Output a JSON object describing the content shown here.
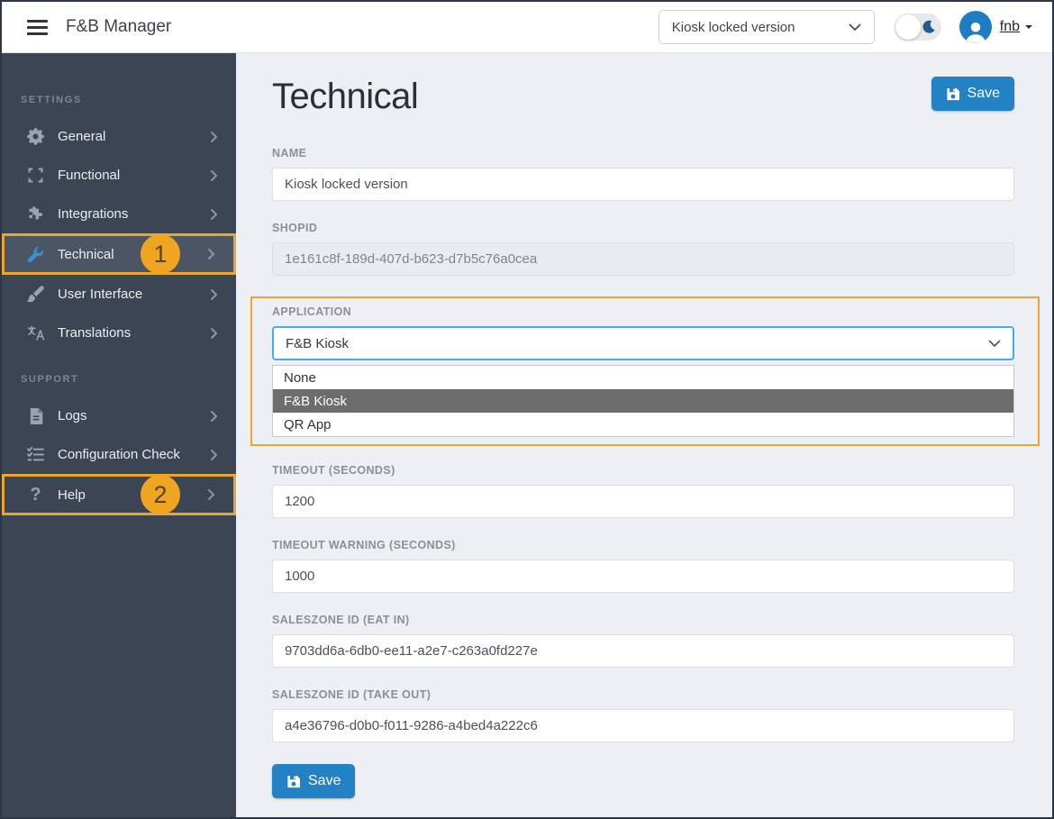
{
  "header": {
    "app_title": "F&B Manager",
    "shop_select": {
      "value": "Kiosk locked version"
    },
    "user_menu": {
      "username": "fnb"
    }
  },
  "sidebar": {
    "sections": [
      {
        "label": "SETTINGS",
        "items": [
          {
            "label": "General",
            "icon": "gear-icon"
          },
          {
            "label": "Functional",
            "icon": "expand-icon"
          },
          {
            "label": "Integrations",
            "icon": "puzzle-icon"
          },
          {
            "label": "Technical",
            "icon": "wrench-icon",
            "active": true,
            "badge": "1"
          },
          {
            "label": "User Interface",
            "icon": "paintbrush-icon"
          },
          {
            "label": "Translations",
            "icon": "translate-icon"
          }
        ]
      },
      {
        "label": "SUPPORT",
        "items": [
          {
            "label": "Logs",
            "icon": "file-icon"
          },
          {
            "label": "Configuration Check",
            "icon": "checklist-icon"
          },
          {
            "label": "Help",
            "icon": "question-icon",
            "badge": "2"
          }
        ]
      }
    ]
  },
  "main": {
    "title": "Technical",
    "save_button": "Save",
    "fields": {
      "name": {
        "label": "NAME",
        "value": "Kiosk locked version"
      },
      "shopid": {
        "label": "SHOPID",
        "value": "1e161c8f-189d-407d-b623-d7b5c76a0cea"
      },
      "application": {
        "label": "APPLICATION",
        "selected": "F&B Kiosk",
        "options": [
          "None",
          "F&B Kiosk",
          "QR App"
        ]
      },
      "timeout": {
        "label": "TIMEOUT (SECONDS)",
        "value": "1200"
      },
      "timeout_warning": {
        "label": "TIMEOUT WARNING (SECONDS)",
        "value": "1000"
      },
      "saleszone_eat_in": {
        "label": "SALESZONE ID (EAT IN)",
        "value": "9703dd6a-6db0-ee11-a2e7-c263a0fd227e"
      },
      "saleszone_take_out": {
        "label": "SALESZONE ID (TAKE OUT)",
        "value": "a4e36796-d0b0-f011-9286-a4bed4a222c6"
      }
    }
  },
  "annotations": {
    "highlight_color": "#eca62f",
    "steps": [
      "1",
      "2"
    ]
  },
  "colors": {
    "sidebar_bg": "#3b4554",
    "sidebar_active_bg": "#4b5563",
    "accent_blue": "#2382c3",
    "avatar_blue": "#1d7dc2",
    "wrench_blue": "#3e8fd0",
    "select_focus_border": "#41b0e6",
    "option_selected_bg": "#6d6d6d",
    "main_bg": "#edeff5",
    "annotation_orange": "#eca62f"
  }
}
